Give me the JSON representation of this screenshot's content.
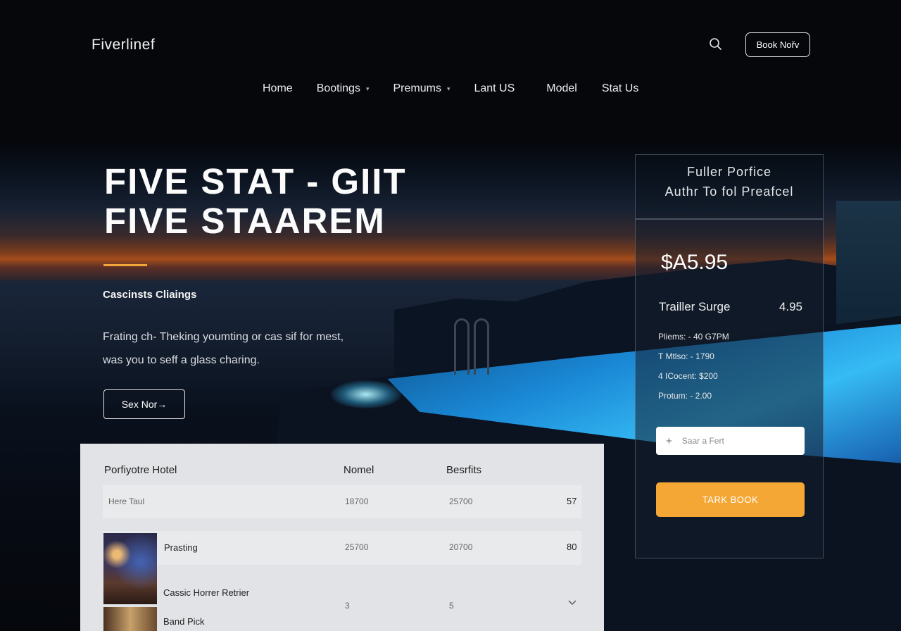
{
  "header": {
    "logo": "Fiverlinef",
    "book_label": "Book Nořv",
    "nav": [
      {
        "label": "Home",
        "dropdown": false
      },
      {
        "label": "Bootings",
        "dropdown": true
      },
      {
        "label": "Premums",
        "dropdown": true
      },
      {
        "label": "Lant US",
        "dropdown": false
      },
      {
        "label": "Model",
        "dropdown": false
      },
      {
        "label": "Stat Us",
        "dropdown": false
      }
    ]
  },
  "hero": {
    "title_line1": "FIVE STAT - GIIT",
    "title_line2": "FIVE STAAREM",
    "subtitle": "Cascinsts Cliaings",
    "desc_line1": "Frating ch- Theking youmting or cas sif for mest,",
    "desc_line2": "was you to seff a glass charing.",
    "cta_label": "Sex Nor→",
    "accent_color": "#f0a63a"
  },
  "pricing": {
    "top_line1": "Fuller Porfice",
    "top_line2": "Authr To fol Preafcel",
    "price": "$A5.95",
    "main_label": "Trailler Surge",
    "main_value": "4.95",
    "details": [
      "Pliems: - 40 G7PM",
      "T Mtlso: - 1790",
      "4 ICocent: $200",
      "Protum: - 2.00"
    ],
    "promo_placeholder": "Saar a Fert",
    "book_cta": "TARK BOOK",
    "cta_color": "#f5a735"
  },
  "table": {
    "headers": [
      "Porfiyotre Hotel",
      "Nomel",
      "Besrfits"
    ],
    "row1": {
      "name": "Here Taul",
      "c1": "18700",
      "c2": "25700",
      "c3": "57"
    },
    "row2": {
      "name": "Prasting",
      "c1": "25700",
      "c2": "20700",
      "c3": "80"
    },
    "row3": {
      "name": "Cassic Horrer Retrier",
      "c1": "3",
      "c2": "5"
    },
    "row4": {
      "name": "Band Pick"
    }
  }
}
